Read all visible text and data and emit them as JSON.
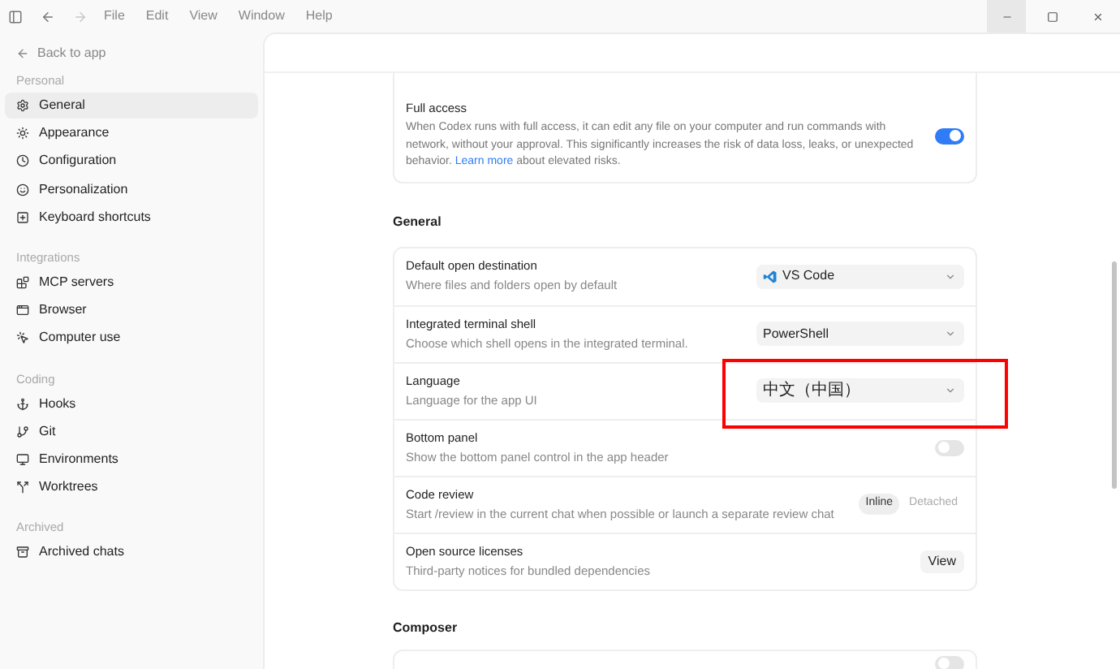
{
  "title_bar": {
    "nav_buttons": [
      {
        "kind": "back",
        "disabled": false
      },
      {
        "kind": "forward",
        "disabled": true
      }
    ],
    "menu": [
      "File",
      "Edit",
      "View",
      "Window",
      "Help"
    ],
    "window_controls": [
      {
        "kind": "minimize",
        "hovered": true
      },
      {
        "kind": "maximize",
        "hovered": false
      },
      {
        "kind": "close",
        "hovered": false
      }
    ]
  },
  "sidebar": {
    "back_link": "Back to app",
    "groups": [
      {
        "title": "Personal",
        "items": [
          {
            "label": "General",
            "selected": true
          },
          {
            "label": "Appearance",
            "selected": false
          },
          {
            "label": "Configuration",
            "selected": false
          },
          {
            "label": "Personalization",
            "selected": false
          },
          {
            "label": "Keyboard shortcuts",
            "selected": false
          }
        ]
      },
      {
        "title": "Integrations",
        "items": [
          {
            "label": "MCP servers",
            "selected": false
          },
          {
            "label": "Browser",
            "selected": false
          },
          {
            "label": "Computer use",
            "selected": false
          }
        ]
      },
      {
        "title": "Coding",
        "items": [
          {
            "label": "Hooks",
            "selected": false
          },
          {
            "label": "Git",
            "selected": false
          },
          {
            "label": "Environments",
            "selected": false
          },
          {
            "label": "Worktrees",
            "selected": false
          }
        ]
      },
      {
        "title": "Archived",
        "items": [
          {
            "label": "Archived chats",
            "selected": false
          }
        ]
      }
    ]
  },
  "full_access": {
    "title": "Full access",
    "description_before": "When Codex runs with full access, it can edit any file on your computer and run commands with network, without your approval. This significantly increases the risk of data loss, leaks, or unexpected behavior.",
    "link": "Learn more",
    "description_after": "about elevated risks.",
    "on": true
  },
  "general": {
    "heading": "General",
    "rows": [
      {
        "kind": "appselect",
        "title": "Default open destination",
        "description": "Where files and folders open by default",
        "value": "VS Code"
      },
      {
        "kind": "select",
        "title": "Integrated terminal shell",
        "description": "Choose which shell opens in the integrated terminal.",
        "value": "PowerShell"
      },
      {
        "kind": "select",
        "title": "Language",
        "description": "Language for the app UI",
        "value": "中文（中国）",
        "highlighted": true
      },
      {
        "kind": "toggle",
        "title": "Bottom panel",
        "description": "Show the bottom panel control in the app header",
        "on": false
      },
      {
        "kind": "segmented",
        "title": "Code review",
        "description": "Start /review in the current chat when possible or launch a separate review chat",
        "options": [
          {
            "label": "Inline",
            "selected": true
          },
          {
            "label": "Detached",
            "selected": false
          }
        ]
      },
      {
        "kind": "button",
        "title": "Open source licenses",
        "description": "Third-party notices for bundled dependencies",
        "button": "View"
      }
    ]
  },
  "composer": {
    "heading": "Composer",
    "toggle_on": false
  }
}
